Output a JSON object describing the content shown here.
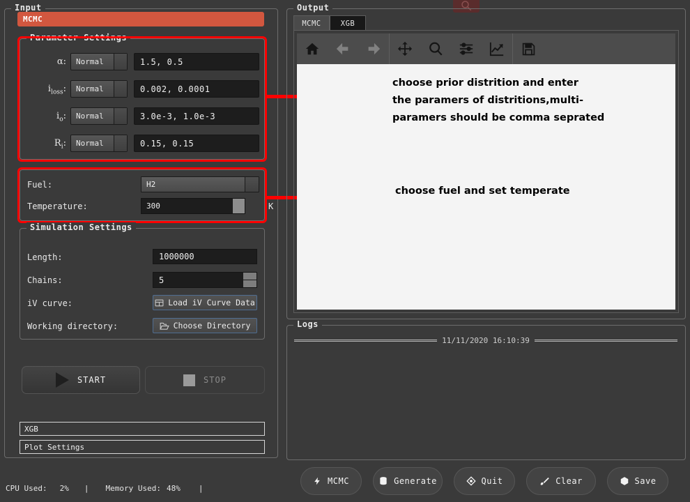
{
  "window": {
    "cut_icon": "search-icon"
  },
  "input": {
    "title": "Input",
    "banner": "MCMC",
    "parameter_settings": {
      "title": "Parameter Settings",
      "rows": [
        {
          "label": "α",
          "sub": "",
          "suffix": ":",
          "distribution": "Normal",
          "value": "1.5, 0.5"
        },
        {
          "label": "i",
          "sub": "loss",
          "suffix": ":",
          "distribution": "Normal",
          "value": "0.002, 0.0001"
        },
        {
          "label": "i",
          "sub": "o",
          "suffix": ":",
          "distribution": "Normal",
          "value": "3.0e-3, 1.0e-3"
        },
        {
          "label": "R",
          "sub": "i",
          "suffix": ":",
          "distribution": "Normal",
          "value": "0.15, 0.15"
        }
      ]
    },
    "fuel_settings": {
      "fuel_label": "Fuel:",
      "fuel_value": "H2",
      "temperature_label": "Temperature:",
      "temperature_value": "300",
      "temperature_unit": "K"
    },
    "simulation_settings": {
      "title": "Simulation Settings",
      "length_label": "Length:",
      "length_value": "1000000",
      "chains_label": "Chains:",
      "chains_value": "5",
      "iv_curve_label": "iV curve:",
      "iv_curve_button": "Load iV Curve Data",
      "iv_curve_icon": "table-icon",
      "working_directory_label": "Working directory:",
      "working_directory_button": "Choose Directory",
      "working_directory_icon": "folder-open-icon"
    },
    "start_button": "START",
    "start_icon": "play-icon",
    "stop_button": "STOP",
    "stop_icon": "square-icon",
    "list_items": [
      {
        "label": "XGB"
      },
      {
        "label": "Plot Settings"
      }
    ]
  },
  "status_bar": {
    "cpu_label": "CPU Used:",
    "cpu_value": "2%",
    "memory_label": "Memory Used:",
    "memory_value": "48%",
    "separator": "|"
  },
  "output": {
    "title": "Output",
    "tabs": [
      {
        "label": "MCMC",
        "active": false
      },
      {
        "label": "XGB",
        "active": true
      }
    ],
    "toolbar": [
      {
        "name": "home-icon",
        "tooltip": "Home"
      },
      {
        "name": "arrow-left-icon",
        "tooltip": "Back"
      },
      {
        "name": "arrow-right-icon",
        "tooltip": "Forward"
      },
      {
        "name": "move-icon",
        "tooltip": "Pan"
      },
      {
        "name": "magnifier-icon",
        "tooltip": "Zoom"
      },
      {
        "name": "sliders-icon",
        "tooltip": "Configure subplots"
      },
      {
        "name": "chart-line-icon",
        "tooltip": "Edit axis"
      },
      {
        "name": "floppy-disk-icon",
        "tooltip": "Save"
      }
    ],
    "annotations": [
      {
        "lines": [
          "choose prior distrition and enter",
          "the paramers of distritions,multi-",
          "paramers should be comma seprated"
        ]
      },
      {
        "lines": [
          "choose fuel and set temperate"
        ]
      }
    ]
  },
  "logs": {
    "title": "Logs",
    "timestamp": "11/11/2020 16:10:39"
  },
  "actions": [
    {
      "label": "MCMC",
      "icon": "bolt-icon"
    },
    {
      "label": "Generate",
      "icon": "database-icon"
    },
    {
      "label": "Quit",
      "icon": "diamond-icon"
    },
    {
      "label": "Clear",
      "icon": "brush-icon"
    },
    {
      "label": "Save",
      "icon": "cube-icon"
    }
  ],
  "colors": {
    "accent": "#d2573f",
    "annotation": "#fe0000",
    "panel": "#3a3a3a",
    "canvas": "#f4f4f4"
  }
}
